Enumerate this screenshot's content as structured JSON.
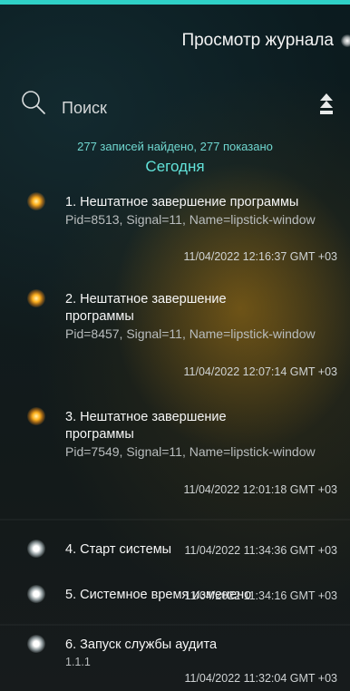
{
  "header": {
    "title": "Просмотр журнала"
  },
  "search": {
    "label": "Поиск"
  },
  "summary": "277 записей найдено, 277 показано",
  "day_header": "Сегодня",
  "colors": {
    "accent": "#2fd1c7",
    "summary_text": "#6fd6cf",
    "warning_dot": "#ffb21f",
    "info_dot": "#ffffff"
  },
  "entries": [
    {
      "title": "1. Нештатное завершение программы",
      "details": "Pid=8513, Signal=11, Name=lipstick-window",
      "time": "11/04/2022 12:16:37 GMT +03",
      "level": "warning"
    },
    {
      "title": "2. Нештатное завершение программы",
      "details": "Pid=8457, Signal=11, Name=lipstick-window",
      "time": "11/04/2022 12:07:14 GMT +03",
      "level": "warning"
    },
    {
      "title": "3. Нештатное завершение программы",
      "details": "Pid=7549, Signal=11, Name=lipstick-window",
      "time": "11/04/2022 12:01:18 GMT +03",
      "level": "warning"
    },
    {
      "title": "4. Старт системы",
      "details": "",
      "time": "11/04/2022 11:34:36 GMT +03",
      "level": "info"
    },
    {
      "title": "5. Системное время изменено",
      "details": "",
      "time": "11/04/2022 11:34:16 GMT +03",
      "level": "info"
    },
    {
      "title": "6. Запуск службы аудита",
      "details": "1.1.1",
      "time": "11/04/2022 11:32:04 GMT +03",
      "level": "info"
    }
  ]
}
